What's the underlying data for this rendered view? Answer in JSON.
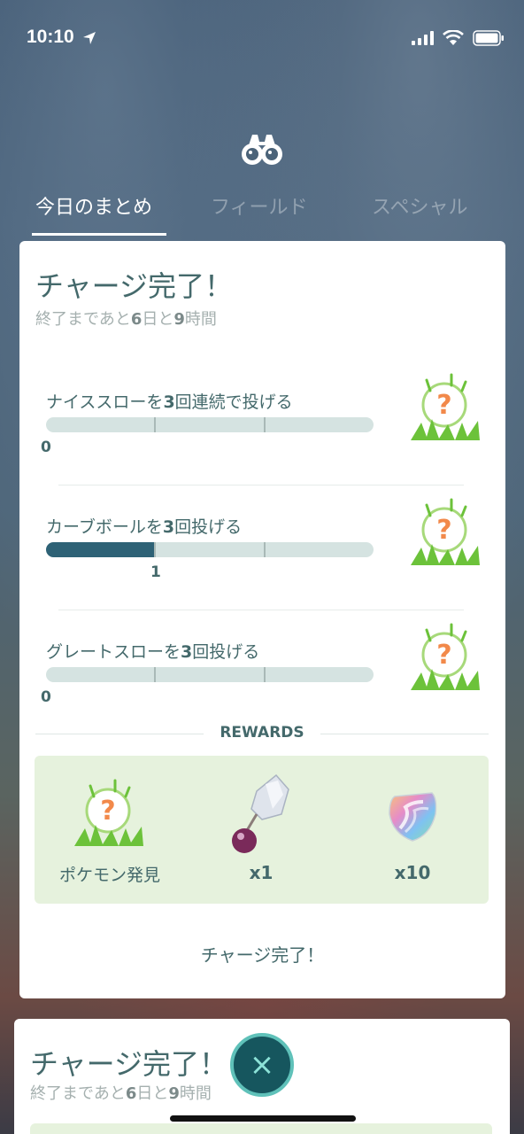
{
  "status_bar": {
    "time": "10:10"
  },
  "tabs": [
    {
      "label": "今日のまとめ",
      "active": true
    },
    {
      "label": "フィールド",
      "active": false
    },
    {
      "label": "スペシャル",
      "active": false
    }
  ],
  "card": {
    "title": "チャージ完了！",
    "subtitle": {
      "prefix": "終了まであと",
      "days": "6",
      "mid": "日と",
      "hours": "9",
      "suffix": "時間"
    },
    "tasks": [
      {
        "label_pre": "ナイススローを",
        "label_num": "3",
        "label_post": "回連続で投げる",
        "count": "0",
        "progress": 0
      },
      {
        "label_pre": "カーブボールを",
        "label_num": "3",
        "label_post": "回投げる",
        "count": "1",
        "progress": 0.3333
      },
      {
        "label_pre": "グレートスローを",
        "label_num": "3",
        "label_post": "回投げる",
        "count": "0",
        "progress": 0
      }
    ],
    "rewards_title": "REWARDS",
    "rewards": [
      {
        "label": "ポケモン発見",
        "icon": "mystery-encounter-icon"
      },
      {
        "label": "x1",
        "icon": "sinnoh-stone-icon"
      },
      {
        "label": "x10",
        "icon": "rare-candy-icon"
      }
    ],
    "footer": "チャージ完了！"
  },
  "card2": {
    "title": "チャージ完了！",
    "subtitle": {
      "prefix": "終了まであと",
      "days": "6",
      "mid": "日と",
      "hours": "9",
      "suffix": "時間"
    }
  },
  "close_button": {
    "glyph": "×"
  },
  "colors": {
    "text": "#44696b",
    "progress": "#2e6276",
    "track": "#d5e3e1",
    "reward_bg": "#e6f2dd",
    "grass": "#6cc23a",
    "question": "#f2894a"
  }
}
